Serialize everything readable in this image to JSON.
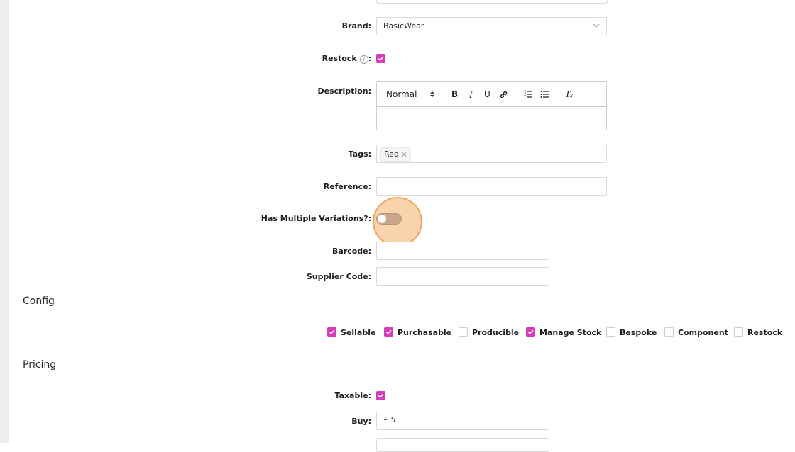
{
  "form": {
    "brand": {
      "label": "Brand",
      "value": "BasicWear"
    },
    "restock": {
      "label": "Restock",
      "checked": true
    },
    "description": {
      "label": "Description",
      "toolbar": {
        "heading_select": "Normal",
        "bold": "B",
        "italic": "I",
        "underline": "U",
        "clear_format": "T"
      }
    },
    "tags": {
      "label": "Tags",
      "items": [
        "Red"
      ],
      "remove_glyph": "×"
    },
    "reference": {
      "label": "Reference",
      "value": ""
    },
    "variations": {
      "label": "Has Multiple Variations?",
      "enabled": false
    },
    "barcode": {
      "label": "Barcode",
      "value": ""
    },
    "supplier_code": {
      "label": "Supplier Code",
      "value": ""
    },
    "colon": ":"
  },
  "config": {
    "title": "Config",
    "options": [
      {
        "label": "Sellable",
        "checked": true
      },
      {
        "label": "Purchasable",
        "checked": true
      },
      {
        "label": "Producible",
        "checked": false
      },
      {
        "label": "Manage Stock",
        "checked": true
      },
      {
        "label": "Bespoke",
        "checked": false
      },
      {
        "label": "Component",
        "checked": false
      },
      {
        "label": "Restock",
        "checked": false
      }
    ]
  },
  "pricing": {
    "title": "Pricing",
    "taxable": {
      "label": "Taxable",
      "checked": true
    },
    "buy": {
      "label": "Buy",
      "value": "£ 5"
    }
  },
  "colors": {
    "accent": "#d63cb8",
    "highlight": "#f5a04a"
  }
}
